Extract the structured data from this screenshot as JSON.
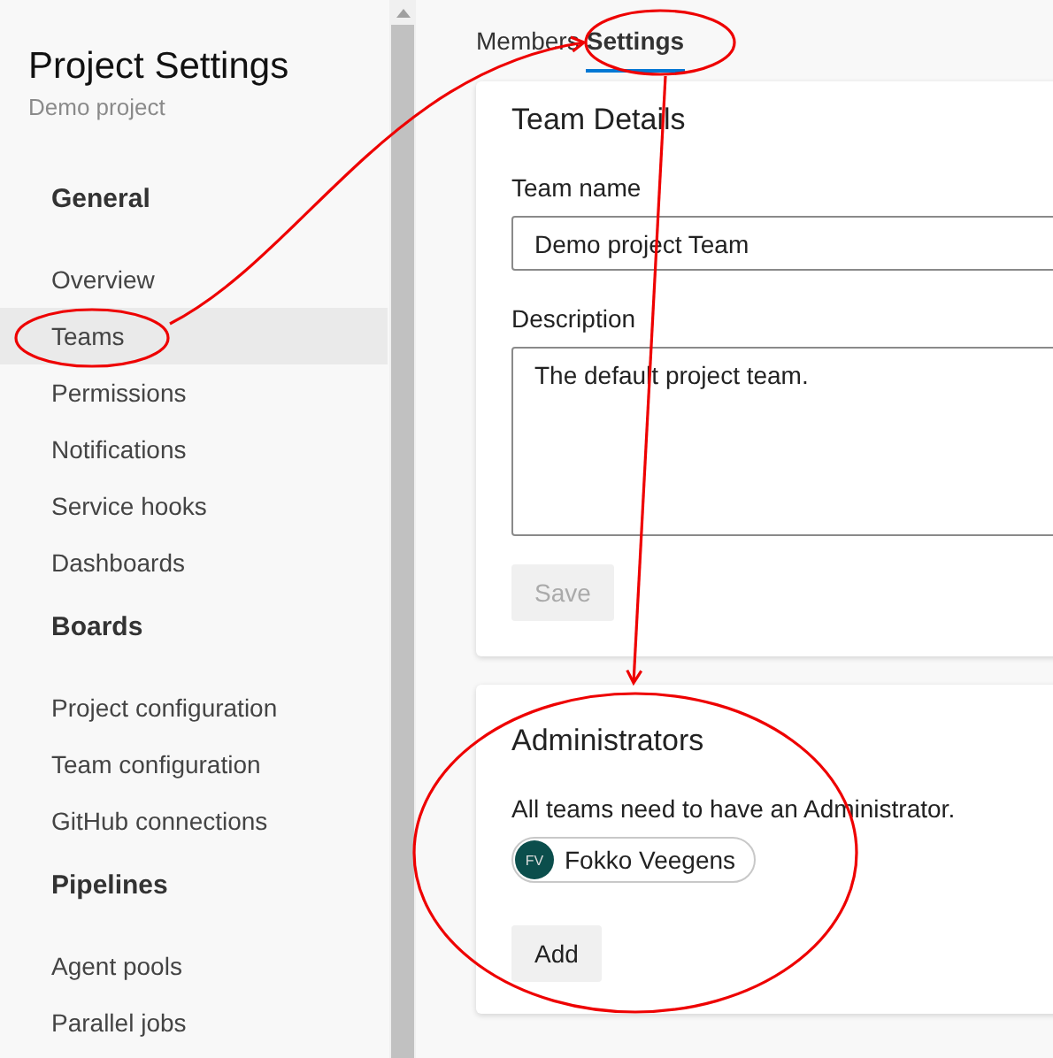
{
  "sidebar": {
    "title": "Project Settings",
    "subtitle": "Demo project",
    "sections": [
      {
        "heading": "General",
        "items": [
          {
            "label": "Overview",
            "selected": false
          },
          {
            "label": "Teams",
            "selected": true
          },
          {
            "label": "Permissions",
            "selected": false
          },
          {
            "label": "Notifications",
            "selected": false
          },
          {
            "label": "Service hooks",
            "selected": false
          },
          {
            "label": "Dashboards",
            "selected": false
          }
        ]
      },
      {
        "heading": "Boards",
        "items": [
          {
            "label": "Project configuration",
            "selected": false
          },
          {
            "label": "Team configuration",
            "selected": false
          },
          {
            "label": "GitHub connections",
            "selected": false
          }
        ]
      },
      {
        "heading": "Pipelines",
        "items": [
          {
            "label": "Agent pools",
            "selected": false
          },
          {
            "label": "Parallel jobs",
            "selected": false
          }
        ]
      }
    ]
  },
  "tabs": [
    {
      "label": "Members",
      "selected": false
    },
    {
      "label": "Settings",
      "selected": true
    }
  ],
  "team_details": {
    "title": "Team Details",
    "name_label": "Team name",
    "name_value": "Demo project Team",
    "description_label": "Description",
    "description_value": "The default project team.",
    "save_button": {
      "label": "Save",
      "disabled": true
    }
  },
  "administrators": {
    "title": "Administrators",
    "note": "All teams need to have an Administrator.",
    "members": [
      {
        "initials": "FV",
        "name": "Fokko Veegens"
      }
    ],
    "add_button": {
      "label": "Add",
      "disabled": false
    }
  }
}
